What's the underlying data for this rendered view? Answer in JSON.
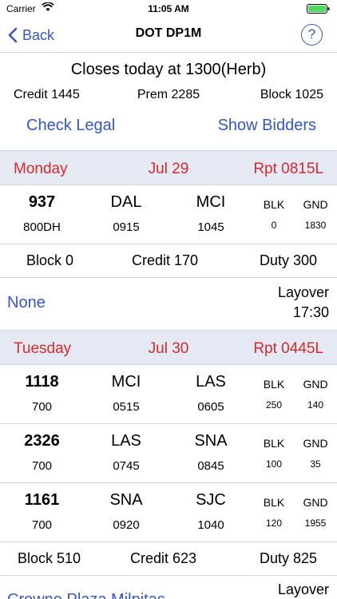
{
  "status_bar": {
    "carrier": "Carrier",
    "time": "11:05 AM"
  },
  "nav": {
    "back_label": "Back",
    "title": "DOT DP1M",
    "help_label": "?"
  },
  "summary": {
    "closes": "Closes today at 1300(Herb)",
    "credit": "Credit 1445",
    "prem": "Prem 2285",
    "block": "Block 1025",
    "check_legal": "Check Legal",
    "show_bidders": "Show Bidders"
  },
  "days": [
    {
      "day": "Monday",
      "date": "Jul 29",
      "rpt": "Rpt 0815L",
      "flights": [
        {
          "number": "937",
          "equipment": "800DH",
          "dep": "DAL",
          "dep_time": "0915",
          "arr": "MCI",
          "arr_time": "1045",
          "blk_label": "BLK",
          "blk": "0",
          "gnd_label": "GND",
          "gnd": "1830"
        }
      ],
      "totals": {
        "block": "Block 0",
        "credit": "Credit 170",
        "duty": "Duty 300"
      },
      "layover": {
        "hotel": "None",
        "label": "Layover",
        "time": "17:30"
      }
    },
    {
      "day": "Tuesday",
      "date": "Jul 30",
      "rpt": "Rpt 0445L",
      "flights": [
        {
          "number": "1118",
          "equipment": "700",
          "dep": "MCI",
          "dep_time": "0515",
          "arr": "LAS",
          "arr_time": "0605",
          "blk_label": "BLK",
          "blk": "250",
          "gnd_label": "GND",
          "gnd": "140"
        },
        {
          "number": "2326",
          "equipment": "700",
          "dep": "LAS",
          "dep_time": "0745",
          "arr": "SNA",
          "arr_time": "0845",
          "blk_label": "BLK",
          "blk": "100",
          "gnd_label": "GND",
          "gnd": "35"
        },
        {
          "number": "1161",
          "equipment": "700",
          "dep": "SNA",
          "dep_time": "0920",
          "arr": "SJC",
          "arr_time": "1040",
          "blk_label": "BLK",
          "blk": "120",
          "gnd_label": "GND",
          "gnd": "1955"
        }
      ],
      "totals": {
        "block": "Block 510",
        "credit": "Credit 623",
        "duty": "Duty 825"
      },
      "layover": {
        "hotel": "Crowne Plaza Milpitas",
        "label": "Layover",
        "time": ""
      }
    }
  ],
  "colors": {
    "accent": "#3457c8",
    "day_header_bg": "#e4e9f3",
    "day_header_text": "#d42a2a",
    "battery": "#4cd964"
  }
}
